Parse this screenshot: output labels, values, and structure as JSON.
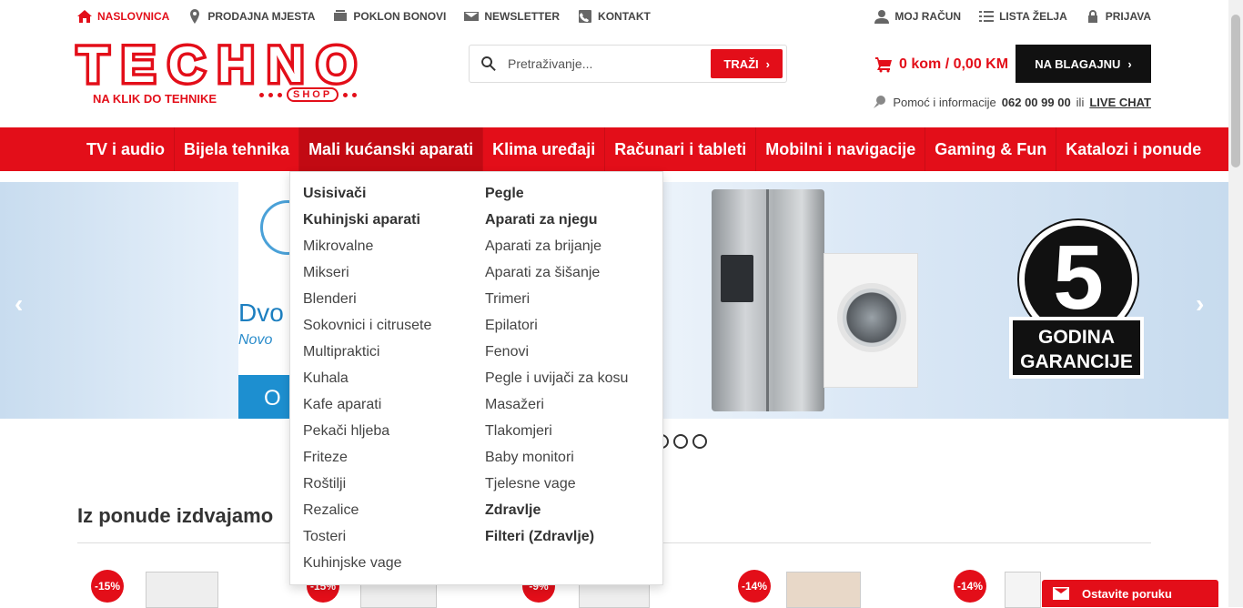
{
  "topbar": {
    "left": [
      {
        "label": "NASLOVNICA",
        "icon": "home-icon"
      },
      {
        "label": "PRODAJNA MJESTA",
        "icon": "map-pin-icon"
      },
      {
        "label": "POKLON BONOVI",
        "icon": "gift-card-icon"
      },
      {
        "label": "NEWSLETTER",
        "icon": "envelope-icon"
      },
      {
        "label": "KONTAKT",
        "icon": "phone-icon"
      }
    ],
    "right": [
      {
        "label": "MOJ RAČUN",
        "icon": "user-icon"
      },
      {
        "label": "LISTA ŽELJA",
        "icon": "list-icon"
      },
      {
        "label": "PRIJAVA",
        "icon": "lock-icon"
      }
    ]
  },
  "logo": {
    "text": "TECHNO",
    "tagline": "NA KLIK DO TEHNIKE",
    "shop": "SHOP"
  },
  "search": {
    "placeholder": "Pretraživanje...",
    "button": "TRAŽI"
  },
  "cart": {
    "summary": "0 kom / 0,00 KM"
  },
  "checkout": {
    "label": "NA BLAGAJNU"
  },
  "help": {
    "text": "Pomoć i informacije",
    "phone": "062 00 99 00",
    "or": "ili",
    "chat": "LIVE CHAT"
  },
  "nav": [
    "TV i audio",
    "Bijela tehnika",
    "Mali kućanski aparati",
    "Klima uređaji",
    "Računari i tableti",
    "Mobilni i navigacije",
    "Gaming & Fun",
    "Katalozi i ponude"
  ],
  "dropdown": {
    "col1": [
      {
        "label": "Usisivači",
        "h": true
      },
      {
        "label": "Kuhinjski aparati",
        "h": true
      },
      {
        "label": "Mikrovalne"
      },
      {
        "label": "Mikseri"
      },
      {
        "label": "Blenderi"
      },
      {
        "label": "Sokovnici i citrusete"
      },
      {
        "label": "Multipraktici"
      },
      {
        "label": "Kuhala"
      },
      {
        "label": "Kafe aparati"
      },
      {
        "label": "Pekači hljeba"
      },
      {
        "label": "Friteze"
      },
      {
        "label": "Roštilji"
      },
      {
        "label": "Rezalice"
      },
      {
        "label": "Tosteri"
      },
      {
        "label": "Kuhinjske vage"
      }
    ],
    "col2": [
      {
        "label": "Pegle",
        "h": true
      },
      {
        "label": "Aparati za njegu",
        "h": true
      },
      {
        "label": "Aparati za brijanje"
      },
      {
        "label": "Aparati za šišanje"
      },
      {
        "label": "Trimeri"
      },
      {
        "label": "Epilatori"
      },
      {
        "label": "Fenovi"
      },
      {
        "label": "Pegle i uvijači za kosu"
      },
      {
        "label": "Masažeri"
      },
      {
        "label": "Tlakomjeri"
      },
      {
        "label": "Baby monitori"
      },
      {
        "label": "Tjelesne vage"
      },
      {
        "label": "Zdravlje",
        "h": true
      },
      {
        "label": "Filteri (Zdravlje)",
        "h": true
      }
    ]
  },
  "banner": {
    "brand_word": "Dvo",
    "sub": "Novo",
    "btn": "O",
    "badge_num": "5",
    "badge_label_1": "GODINA",
    "badge_label_2": "GARANCIJE",
    "prev": "‹",
    "next": "›"
  },
  "section": {
    "title": "Iz ponude izdvajamo"
  },
  "discounts": [
    "-15%",
    "-15%",
    "-9%",
    "-14%",
    "-14%"
  ],
  "chat_widget": {
    "label": "Ostavite poruku"
  },
  "colors": {
    "brand_red": "#e30e19",
    "dark": "#111111"
  }
}
